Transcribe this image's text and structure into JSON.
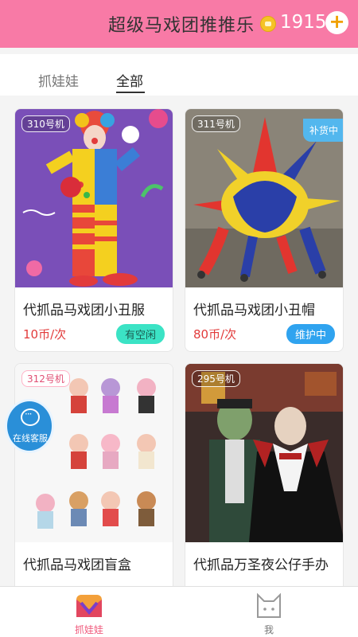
{
  "header": {
    "title": "超级马戏团推推乐",
    "coins": "1915",
    "coin_icon": "coin-icon",
    "add_icon": "plus-icon",
    "add_label": "+"
  },
  "tabs": [
    {
      "label": "抓娃娃",
      "active": false
    },
    {
      "label": "全部",
      "active": true
    }
  ],
  "cards": [
    {
      "machine": "310号机",
      "name": "代抓品马戏团小丑服",
      "price": "10币/次",
      "status": "有空闲",
      "badge": ""
    },
    {
      "machine": "311号机",
      "name": "代抓品马戏团小丑帽",
      "price": "80币/次",
      "status": "维护中",
      "badge": "补货中"
    },
    {
      "machine": "312号机",
      "name": "代抓品马戏团盲盒",
      "price": "",
      "status": "",
      "badge": ""
    },
    {
      "machine": "295号机",
      "name": "代抓品万圣夜公仔手办",
      "price": "",
      "status": "",
      "badge": ""
    }
  ],
  "float_service": {
    "label": "在线客服",
    "icon": "chat-icon"
  },
  "bottom_nav": [
    {
      "label": "抓娃娃",
      "icon": "claw-logo-icon",
      "active": true
    },
    {
      "label": "我",
      "icon": "cat-face-icon",
      "active": false
    }
  ],
  "colors": {
    "header_bg": "#f87aa6",
    "price_red": "#e23b3b",
    "idle_green": "#3be3c5",
    "maint_blue": "#2fa3ef",
    "nav_active": "#f05b7d"
  }
}
